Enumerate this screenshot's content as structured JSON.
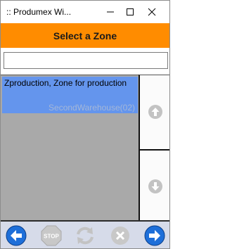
{
  "window": {
    "title": ":: Produmex Wi...",
    "minimize_icon": "minimize-icon",
    "maximize_icon": "maximize-icon",
    "close_icon": "close-icon"
  },
  "header": {
    "title": "Select a Zone"
  },
  "search": {
    "value": "",
    "placeholder": ""
  },
  "list": {
    "items": [
      {
        "name": "Zproduction, Zone for production",
        "warehouse": "SecondWarehouse(02)"
      }
    ]
  },
  "scroll": {
    "up_icon": "arrow-up-circle-icon",
    "down_icon": "arrow-down-circle-icon"
  },
  "toolbar": {
    "back_icon": "back-arrow-icon",
    "stop_label": "STOP",
    "refresh_icon": "refresh-icon",
    "cancel_icon": "cancel-icon",
    "next_icon": "next-arrow-icon"
  },
  "colors": {
    "header": "#ff8c00",
    "selected_row": "#6495ed",
    "list_bg": "#a9a9a9",
    "nav_blue": "#1e6fd9",
    "disabled_gray": "#c8c8c8"
  }
}
